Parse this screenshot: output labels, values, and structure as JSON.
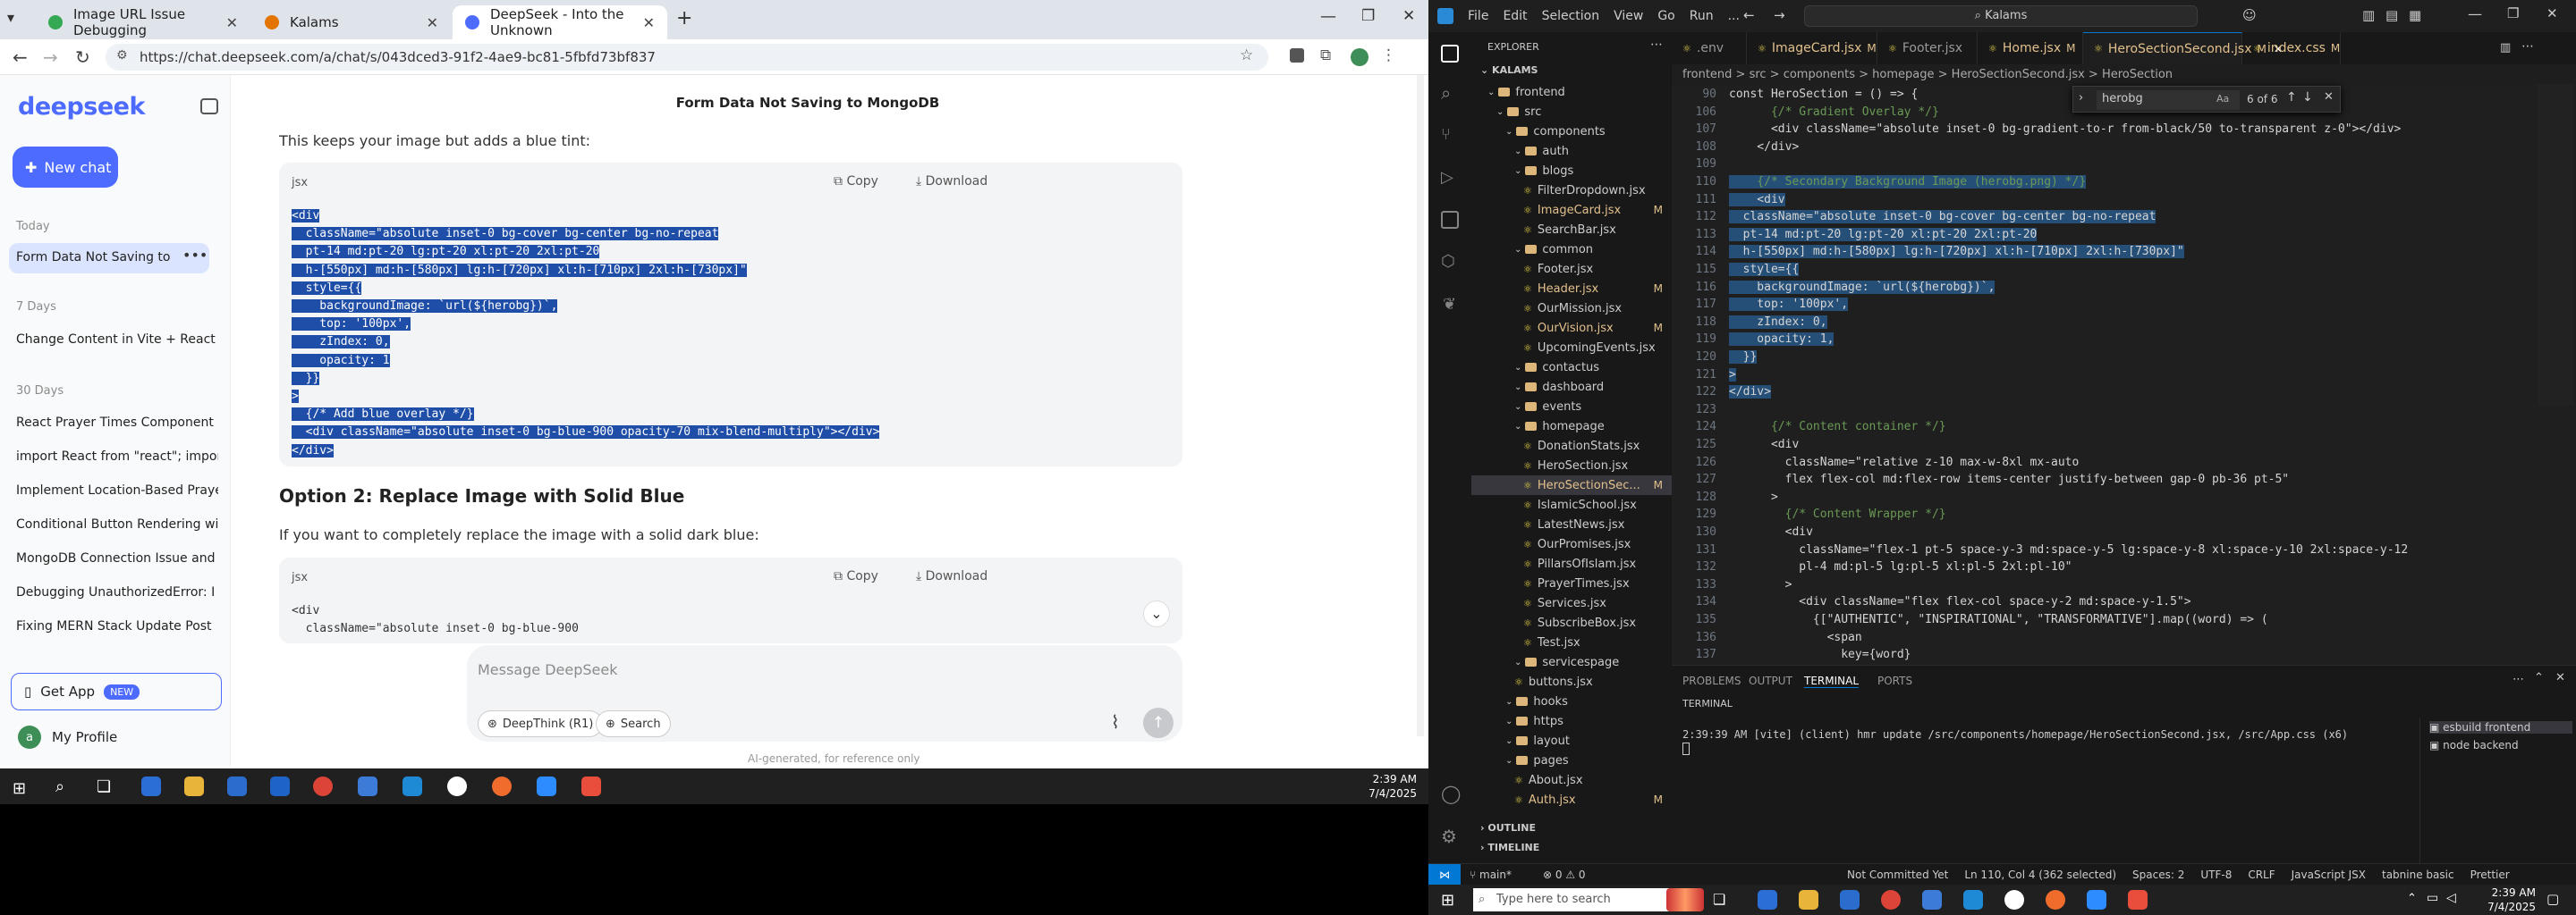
{
  "chrome": {
    "tabs": [
      {
        "title": "Image URL Issue Debugging",
        "color": "#34a853"
      },
      {
        "title": "Kalams",
        "color": "#e37400"
      },
      {
        "title": "DeepSeek - Into the Unknown",
        "color": "#4d6bfe"
      }
    ],
    "url": "https://chat.deepseek.com/a/chat/s/043dced3-91f2-4ae9-bc81-5fbfd73bf837"
  },
  "deepseek": {
    "logo": "deepseek",
    "new_chat": "New chat",
    "groups": [
      {
        "label": "Today",
        "items": [
          "Form Data Not Saving to M"
        ]
      },
      {
        "label": "7 Days",
        "items": [
          "Change Content in Vite + React"
        ]
      },
      {
        "label": "30 Days",
        "items": [
          "React Prayer Times Component",
          "import React from \"react\"; impor",
          "Implement Location-Based Praye",
          "Conditional Button Rendering wi",
          "MongoDB Connection Issue and",
          "Debugging UnauthorizedError: I",
          "Fixing MERN Stack Update Post"
        ]
      }
    ],
    "get_app": "Get App",
    "new_badge": "NEW",
    "profile": "My Profile",
    "avatar_letter": "a",
    "chat_title": "Form Data Not Saving to MongoDB",
    "intro": "This keeps your image but adds a blue tint:",
    "code_lang": "jsx",
    "copy": "Copy",
    "download": "Download",
    "code1": [
      "<div",
      "  className=\"absolute inset-0 bg-cover bg-center bg-no-repeat",
      "  pt-14 md:pt-20 lg:pt-20 xl:pt-20 2xl:pt-20",
      "  h-[550px] md:h-[580px] lg:h-[720px] xl:h-[710px] 2xl:h-[730px]\"",
      "  style={{",
      "    backgroundImage: `url(${herobg})`,",
      "    top: '100px',",
      "    zIndex: 0,",
      "    opacity: 1",
      "  }}",
      ">",
      "  {/* Add blue overlay */}",
      "  <div className=\"absolute inset-0 bg-blue-900 opacity-70 mix-blend-multiply\"></div>",
      "</div>"
    ],
    "option2_title": "Option 2: Replace Image with Solid Blue",
    "option2_text": "If you want to completely replace the image with a solid dark blue:",
    "code2": [
      "<div",
      "  className=\"absolute inset-0 bg-blue-900"
    ],
    "message_placeholder": "Message DeepSeek",
    "deepthink": "DeepThink (R1)",
    "search": "Search",
    "footnote": "AI-generated, for reference only"
  },
  "vscode": {
    "menu": [
      "File",
      "Edit",
      "Selection",
      "View",
      "Go",
      "Run",
      "..."
    ],
    "search_box": "Kalams",
    "explorer_title": "EXPLORER",
    "root": "KALAMS",
    "tree": [
      {
        "name": "frontend",
        "type": "folder",
        "depth": 1
      },
      {
        "name": "src",
        "type": "folder",
        "depth": 2
      },
      {
        "name": "components",
        "type": "folder",
        "depth": 3
      },
      {
        "name": "auth",
        "type": "folder",
        "depth": 4
      },
      {
        "name": "blogs",
        "type": "folder",
        "depth": 4
      },
      {
        "name": "FilterDropdown.jsx",
        "type": "file",
        "depth": 5
      },
      {
        "name": "ImageCard.jsx",
        "type": "file",
        "depth": 5,
        "mod": "M"
      },
      {
        "name": "SearchBar.jsx",
        "type": "file",
        "depth": 5
      },
      {
        "name": "common",
        "type": "folder",
        "depth": 4
      },
      {
        "name": "Footer.jsx",
        "type": "file",
        "depth": 5
      },
      {
        "name": "Header.jsx",
        "type": "file",
        "depth": 5,
        "mod": "M"
      },
      {
        "name": "OurMission.jsx",
        "type": "file",
        "depth": 5
      },
      {
        "name": "OurVision.jsx",
        "type": "file",
        "depth": 5,
        "mod": "M"
      },
      {
        "name": "UpcomingEvents.jsx",
        "type": "file",
        "depth": 5
      },
      {
        "name": "contactus",
        "type": "folder",
        "depth": 4
      },
      {
        "name": "dashboard",
        "type": "folder",
        "depth": 4
      },
      {
        "name": "events",
        "type": "folder",
        "depth": 4
      },
      {
        "name": "homepage",
        "type": "folder",
        "depth": 4
      },
      {
        "name": "DonationStats.jsx",
        "type": "file",
        "depth": 5
      },
      {
        "name": "HeroSection.jsx",
        "type": "file",
        "depth": 5
      },
      {
        "name": "HeroSectionSec...",
        "type": "file",
        "depth": 5,
        "mod": "M",
        "active": true
      },
      {
        "name": "IslamicSchool.jsx",
        "type": "file",
        "depth": 5
      },
      {
        "name": "LatestNews.jsx",
        "type": "file",
        "depth": 5
      },
      {
        "name": "OurPromises.jsx",
        "type": "file",
        "depth": 5
      },
      {
        "name": "PillarsOfIslam.jsx",
        "type": "file",
        "depth": 5
      },
      {
        "name": "PrayerTimes.jsx",
        "type": "file",
        "depth": 5
      },
      {
        "name": "Services.jsx",
        "type": "file",
        "depth": 5
      },
      {
        "name": "SubscribeBox.jsx",
        "type": "file",
        "depth": 5
      },
      {
        "name": "Test.jsx",
        "type": "file",
        "depth": 5
      },
      {
        "name": "servicespage",
        "type": "folder",
        "depth": 4
      },
      {
        "name": "buttons.jsx",
        "type": "file",
        "depth": 4
      },
      {
        "name": "hooks",
        "type": "folder",
        "depth": 3
      },
      {
        "name": "https",
        "type": "folder",
        "depth": 3
      },
      {
        "name": "layout",
        "type": "folder",
        "depth": 3
      },
      {
        "name": "pages",
        "type": "folder",
        "depth": 3
      },
      {
        "name": "About.jsx",
        "type": "file",
        "depth": 4
      },
      {
        "name": "Auth.jsx",
        "type": "file",
        "depth": 4,
        "mod": "M"
      }
    ],
    "outline": "OUTLINE",
    "timeline": "TIMELINE",
    "tabs": [
      {
        "name": ".env",
        "mod": ""
      },
      {
        "name": "ImageCard.jsx",
        "mod": "M"
      },
      {
        "name": "Footer.jsx",
        "mod": ""
      },
      {
        "name": "Home.jsx",
        "mod": "M"
      },
      {
        "name": "HeroSectionSecond.jsx",
        "mod": "M",
        "on": true
      },
      {
        "name": "index.css",
        "mod": "M"
      }
    ],
    "breadcrumb": "frontend > src > components > homepage > HeroSectionSecond.jsx > HeroSection",
    "find_query": "herobg",
    "find_result": "6 of 6",
    "code": [
      {
        "n": "90",
        "t": "const HeroSection = () => {"
      },
      {
        "n": "106",
        "t": "      {/* Gradient Overlay */}"
      },
      {
        "n": "107",
        "t": "      <div className=\"absolute inset-0 bg-gradient-to-r from-black/50 to-transparent z-0\"></div>"
      },
      {
        "n": "108",
        "t": "    </div>"
      },
      {
        "n": "109",
        "t": ""
      },
      {
        "n": "110",
        "t": "    {/* Secondary Background Image (herobg.png) */}",
        "s": true
      },
      {
        "n": "111",
        "t": "    <div",
        "s": true
      },
      {
        "n": "112",
        "t": "  className=\"absolute inset-0 bg-cover bg-center bg-no-repeat",
        "s": true
      },
      {
        "n": "113",
        "t": "  pt-14 md:pt-20 lg:pt-20 xl:pt-20 2xl:pt-20",
        "s": true
      },
      {
        "n": "114",
        "t": "  h-[550px] md:h-[580px] lg:h-[720px] xl:h-[710px] 2xl:h-[730px]\"",
        "s": true
      },
      {
        "n": "115",
        "t": "  style={{",
        "s": true
      },
      {
        "n": "116",
        "t": "    backgroundImage: `url(${herobg})`,",
        "s": true
      },
      {
        "n": "117",
        "t": "    top: '100px',",
        "s": true
      },
      {
        "n": "118",
        "t": "    zIndex: 0,",
        "s": true
      },
      {
        "n": "119",
        "t": "    opacity: 1,",
        "s": true
      },
      {
        "n": "120",
        "t": "  }}",
        "s": true
      },
      {
        "n": "121",
        "t": ">",
        "s": true
      },
      {
        "n": "122",
        "t": "</div>",
        "s": true
      },
      {
        "n": "123",
        "t": ""
      },
      {
        "n": "124",
        "t": "      {/* Content container */}"
      },
      {
        "n": "125",
        "t": "      <div"
      },
      {
        "n": "126",
        "t": "        className=\"relative z-10 max-w-8xl mx-auto"
      },
      {
        "n": "127",
        "t": "        flex flex-col md:flex-row items-center justify-between gap-0 pb-36 pt-5\""
      },
      {
        "n": "128",
        "t": "      >"
      },
      {
        "n": "129",
        "t": "        {/* Content Wrapper */}"
      },
      {
        "n": "130",
        "t": "        <div"
      },
      {
        "n": "131",
        "t": "          className=\"flex-1 pt-5 space-y-3 md:space-y-5 lg:space-y-8 xl:space-y-10 2xl:space-y-12"
      },
      {
        "n": "132",
        "t": "          pl-4 md:pl-5 lg:pl-5 xl:pl-5 2xl:pl-10\""
      },
      {
        "n": "133",
        "t": "        >"
      },
      {
        "n": "134",
        "t": "          <div className=\"flex flex-col space-y-2 md:space-y-1.5\">"
      },
      {
        "n": "135",
        "t": "            {[\"AUTHENTIC\", \"INSPIRATIONAL\", \"TRANSFORMATIVE\"].map((word) => ("
      },
      {
        "n": "136",
        "t": "              <span"
      },
      {
        "n": "137",
        "t": "                key={word}"
      },
      {
        "n": "138",
        "t": "                className=\"text-[#0089A9] bg-[#f9fc53] uppercase inline-block rounded-full py-1.5 px-"
      }
    ],
    "panel_tabs": [
      "PROBLEMS",
      "OUTPUT",
      "TERMINAL",
      "PORTS"
    ],
    "terminal_label": "TERMINAL",
    "terminal_line": "2:39:39 AM [vite] (client) hmr update /src/components/homepage/HeroSectionSecond.jsx, /src/App.css (x6)",
    "terminals": [
      "esbuild frontend",
      "node backend"
    ],
    "status_left": "main*",
    "status_errors": "0 ⚠ 0",
    "status_right": [
      "Not Committed Yet",
      "Ln 110, Col 4 (362 selected)",
      "Spaces: 2",
      "UTF-8",
      "CRLF",
      "JavaScript JSX",
      "tabnine basic",
      "Prettier"
    ]
  },
  "taskbar": {
    "time": "2:39 AM",
    "date": "7/4/2025",
    "search_placeholder": "Type here to search"
  }
}
